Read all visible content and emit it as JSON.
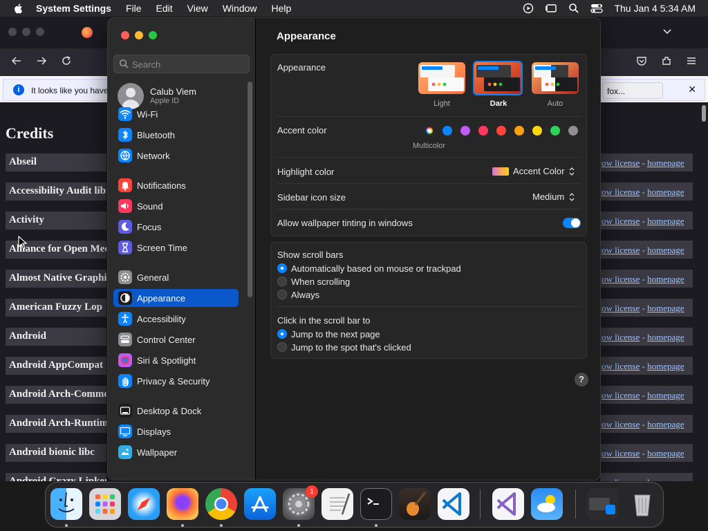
{
  "menubar": {
    "app_name": "System Settings",
    "menus": [
      "File",
      "Edit",
      "View",
      "Window",
      "Help"
    ],
    "clock": "Thu Jan 4  5:34 AM"
  },
  "browser": {
    "notification_text": "It looks like you have",
    "notification_button": "fox...",
    "page_title": "Credits",
    "credits": [
      "Abseil",
      "Accessibility Audit libr",
      "Activity",
      "Alliance for Open Med",
      "Almost Native Graphi",
      "American Fuzzy Lop",
      "Android",
      "Android AppCompat",
      "Android Arch-Commo",
      "Android Arch-Runtim",
      "Android bionic libc",
      "Android Crazy Linker"
    ],
    "link_show_license": "ow license",
    "link_separator": " - ",
    "link_homepage": "homepage"
  },
  "settings": {
    "search_placeholder": "Search",
    "account_name": "Calub Viem",
    "account_sub": "Apple ID",
    "sidebar": [
      {
        "label": "Wi-Fi",
        "icon": "wifi-icon",
        "color": "#0a84ff"
      },
      {
        "label": "Bluetooth",
        "icon": "bluetooth-icon",
        "color": "#0a84ff"
      },
      {
        "label": "Network",
        "icon": "globe-icon",
        "color": "#0a84ff"
      },
      {
        "label": "Notifications",
        "icon": "bell-icon",
        "color": "#ff453a"
      },
      {
        "label": "Sound",
        "icon": "speaker-icon",
        "color": "#ff375f"
      },
      {
        "label": "Focus",
        "icon": "moon-icon",
        "color": "#5e5ce6"
      },
      {
        "label": "Screen Time",
        "icon": "hourglass-icon",
        "color": "#5e5ce6"
      },
      {
        "label": "General",
        "icon": "gear-icon",
        "color": "#8e8e93"
      },
      {
        "label": "Appearance",
        "icon": "appearance-icon",
        "color": "#1c1c1e"
      },
      {
        "label": "Accessibility",
        "icon": "accessibility-icon",
        "color": "#0a84ff"
      },
      {
        "label": "Control Center",
        "icon": "control-center-icon",
        "color": "#8e8e93"
      },
      {
        "label": "Siri & Spotlight",
        "icon": "siri-icon",
        "color": "#bf5af2"
      },
      {
        "label": "Privacy & Security",
        "icon": "hand-icon",
        "color": "#0a84ff"
      },
      {
        "label": "Desktop & Dock",
        "icon": "dock-icon",
        "color": "#1c1c1e"
      },
      {
        "label": "Displays",
        "icon": "display-icon",
        "color": "#0a84ff"
      },
      {
        "label": "Wallpaper",
        "icon": "wallpaper-icon",
        "color": "#32ade6"
      }
    ],
    "selected_item": "Appearance",
    "pane_title": "Appearance",
    "appearance_label": "Appearance",
    "appearance_options": [
      "Light",
      "Dark",
      "Auto"
    ],
    "appearance_selected": "Dark",
    "accent_label": "Accent color",
    "accent_selected_name": "Multicolor",
    "accent_colors": [
      "#0a84ff",
      "#bf5af2",
      "#ff375f",
      "#ff453a",
      "#ff9f0a",
      "#ffd60a",
      "#30d158",
      "#8e8e93"
    ],
    "highlight_label": "Highlight color",
    "highlight_value": "Accent Color",
    "sidebar_icon_label": "Sidebar icon size",
    "sidebar_icon_value": "Medium",
    "tinting_label": "Allow wallpaper tinting in windows",
    "tinting_on": true,
    "scroll_bars_label": "Show scroll bars",
    "scroll_bars_options": [
      "Automatically based on mouse or trackpad",
      "When scrolling",
      "Always"
    ],
    "scroll_bars_selected": "Automatically based on mouse or trackpad",
    "click_scroll_label": "Click in the scroll bar to",
    "click_scroll_options": [
      "Jump to the next page",
      "Jump to the spot that's clicked"
    ],
    "click_scroll_selected": "Jump to the next page",
    "help": "?"
  },
  "dock": {
    "apps": [
      "Finder",
      "Launchpad",
      "Safari",
      "Firefox",
      "Chrome",
      "App Store",
      "System Settings",
      "TextEdit",
      "Terminal",
      "GarageBand",
      "Visual Studio Code",
      "Visual Studio",
      "Weather",
      "Downloads",
      "Trash"
    ],
    "settings_badge": "1"
  }
}
